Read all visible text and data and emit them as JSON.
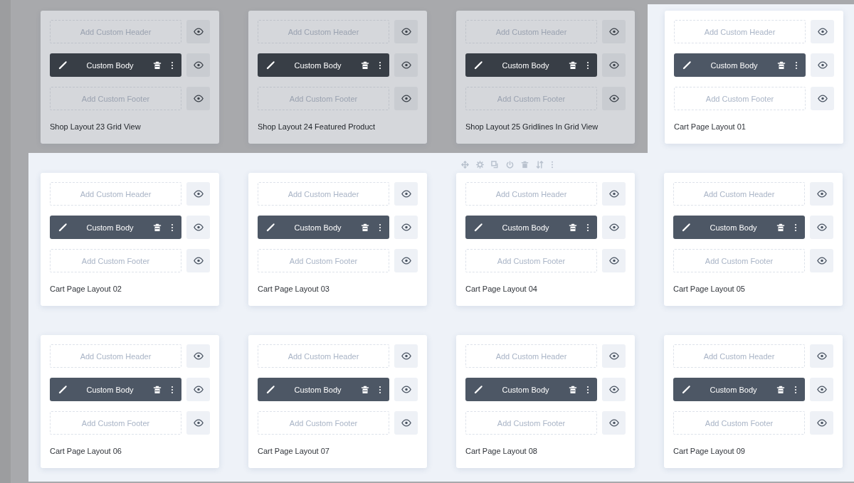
{
  "rows": [
    {
      "cards": [
        {
          "title": "Shop Layout 23 Grid View",
          "dimmed": true,
          "header": "Add Custom Header",
          "body": "Custom Body",
          "footer": "Add Custom Footer"
        },
        {
          "title": "Shop Layout 24 Featured Product",
          "dimmed": true,
          "header": "Add Custom Header",
          "body": "Custom Body",
          "footer": "Add Custom Footer"
        },
        {
          "title": "Shop Layout 25 Gridlines In Grid View",
          "dimmed": true,
          "header": "Add Custom Header",
          "body": "Custom Body",
          "footer": "Add Custom Footer"
        },
        {
          "title": "Cart Page Layout 01",
          "dimmed": false,
          "header": "Add Custom Header",
          "body": "Custom Body",
          "footer": "Add Custom Footer"
        }
      ]
    },
    {
      "cards": [
        {
          "title": "Cart Page Layout 02",
          "dimmed": false,
          "header": "Add Custom Header",
          "body": "Custom Body",
          "footer": "Add Custom Footer"
        },
        {
          "title": "Cart Page Layout 03",
          "dimmed": false,
          "header": "Add Custom Header",
          "body": "Custom Body",
          "footer": "Add Custom Footer"
        },
        {
          "title": "Cart Page Layout 04",
          "dimmed": false,
          "header": "Add Custom Header",
          "body": "Custom Body",
          "footer": "Add Custom Footer"
        },
        {
          "title": "Cart Page Layout 05",
          "dimmed": false,
          "header": "Add Custom Header",
          "body": "Custom Body",
          "footer": "Add Custom Footer"
        }
      ]
    },
    {
      "cards": [
        {
          "title": "Cart Page Layout 06",
          "dimmed": false,
          "header": "Add Custom Header",
          "body": "Custom Body",
          "footer": "Add Custom Footer"
        },
        {
          "title": "Cart Page Layout 07",
          "dimmed": false,
          "header": "Add Custom Header",
          "body": "Custom Body",
          "footer": "Add Custom Footer"
        },
        {
          "title": "Cart Page Layout 08",
          "dimmed": false,
          "header": "Add Custom Header",
          "body": "Custom Body",
          "footer": "Add Custom Footer"
        },
        {
          "title": "Cart Page Layout 09",
          "dimmed": false,
          "header": "Add Custom Header",
          "body": "Custom Body",
          "footer": "Add Custom Footer"
        }
      ]
    }
  ]
}
